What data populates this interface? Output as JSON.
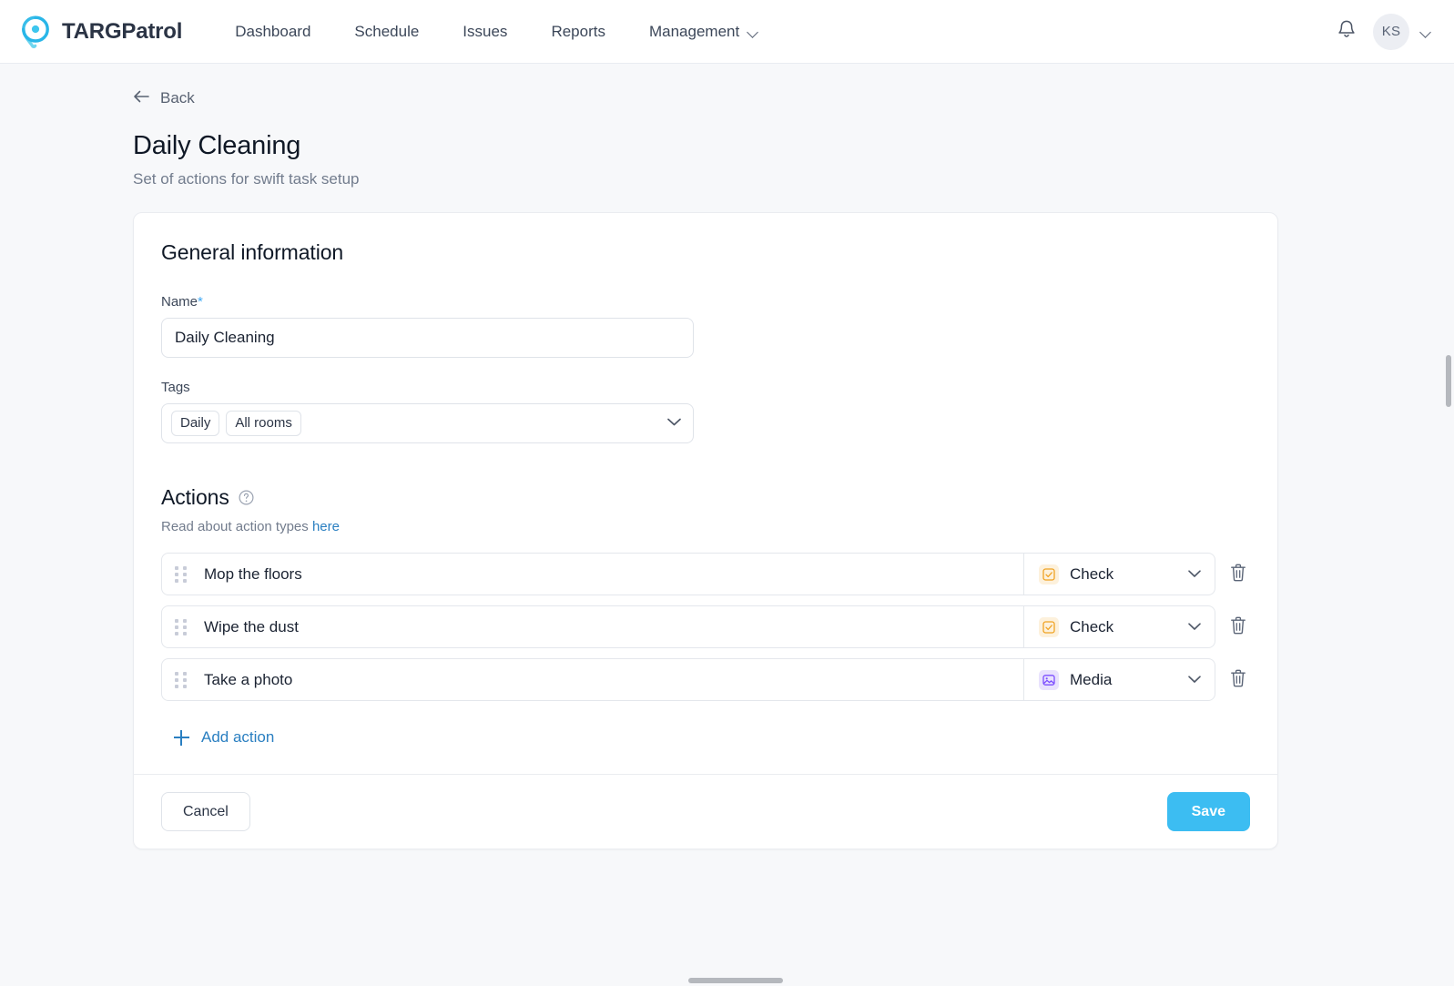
{
  "navbar": {
    "brand": "TARGPatrol",
    "logo_icon": "location-pin-icon",
    "links": [
      {
        "label": "Dashboard",
        "has_caret": false
      },
      {
        "label": "Schedule",
        "has_caret": false
      },
      {
        "label": "Issues",
        "has_caret": false
      },
      {
        "label": "Reports",
        "has_caret": false
      },
      {
        "label": "Management",
        "has_caret": true
      }
    ],
    "notifications_icon": "bell-icon",
    "avatar_initials": "KS",
    "avatar_caret_icon": "chevron-down-icon"
  },
  "header": {
    "back_label": "Back",
    "back_icon": "arrow-left-icon",
    "title": "Daily Cleaning",
    "subtitle": "Set of actions for swift task setup"
  },
  "general": {
    "section_title": "General information",
    "name_label": "Name",
    "name_required_mark": "*",
    "name_value": "Daily Cleaning",
    "name_placeholder": "Name",
    "tags_label": "Tags",
    "tags": [
      "Daily",
      "All rooms"
    ],
    "tags_caret_icon": "chevron-down-icon"
  },
  "actions": {
    "title": "Actions",
    "help_icon": "question-circle-icon",
    "hint_prefix": "Read about action types",
    "hint_link": "here",
    "rows": [
      {
        "drag_icon": "drag-handle-icon",
        "name": "Mop the floors",
        "type": "Check",
        "type_icon": "check-square-icon",
        "type_icon_color": "#f5a623",
        "type_icon_bg": "#fdf1dc",
        "delete_icon": "trash-icon"
      },
      {
        "drag_icon": "drag-handle-icon",
        "name": "Wipe the dust",
        "type": "Check",
        "type_icon": "check-square-icon",
        "type_icon_color": "#f5a623",
        "type_icon_bg": "#fdf1dc",
        "delete_icon": "trash-icon"
      },
      {
        "drag_icon": "drag-handle-icon",
        "name": "Take a photo",
        "type": "Media",
        "type_icon": "image-icon",
        "type_icon_color": "#7c4dff",
        "type_icon_bg": "#e9e2fd",
        "delete_icon": "trash-icon"
      }
    ],
    "add_label": "Add action",
    "add_icon": "plus-icon"
  },
  "footer": {
    "cancel_label": "Cancel",
    "save_label": "Save",
    "save_color": "#3cbdf2"
  }
}
